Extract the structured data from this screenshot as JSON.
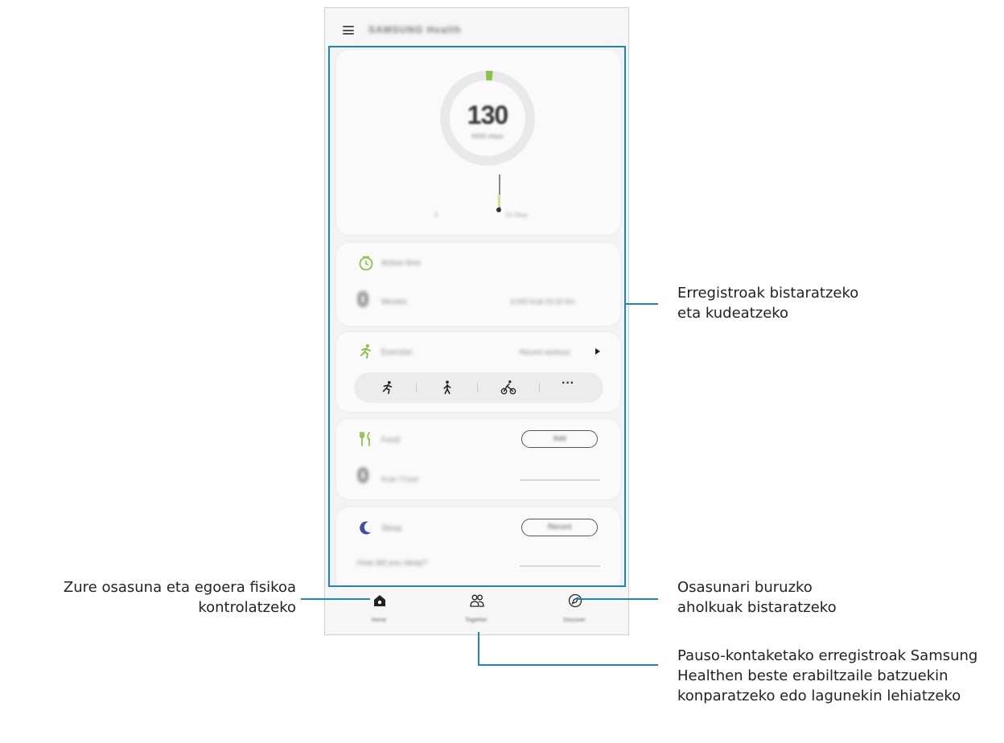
{
  "app": {
    "title": "SAMSUNG Health"
  },
  "steps_card": {
    "count": "130",
    "subtitle": "6000 steps",
    "axis_left": "0",
    "axis_right": "10 Step"
  },
  "active_card": {
    "title": "Active time",
    "value": "0",
    "unit": "Minutes",
    "summary": "3,000 kcal  16.03 km"
  },
  "exercise_card": {
    "title": "Exercise",
    "link": "Recent workout",
    "more": "···"
  },
  "food_card": {
    "title": "Food",
    "value": "0",
    "unit": "Kcal / Food",
    "button": "Add"
  },
  "sleep_card": {
    "title": "Sleep",
    "question": "How did you sleep?",
    "button": "Record"
  },
  "nav": {
    "home": "Home",
    "together": "Together",
    "discover": "Discover"
  },
  "annotations": {
    "records": "Erregistroak bistaratzeko eta kudeatzeko",
    "health_status": "Zure osasuna eta egoera fisikoa kontrolatzeko",
    "tips": "Osasunari buruzko aholkuak bistaratzeko",
    "compare": "Pauso-kontaketako erregistroak Samsung Healthen beste erabiltzaile batzuekin konparatzeko edo lagunekin lehiatzeko"
  },
  "colors": {
    "accent": "#1d84c0",
    "green": "#8bc34a"
  }
}
